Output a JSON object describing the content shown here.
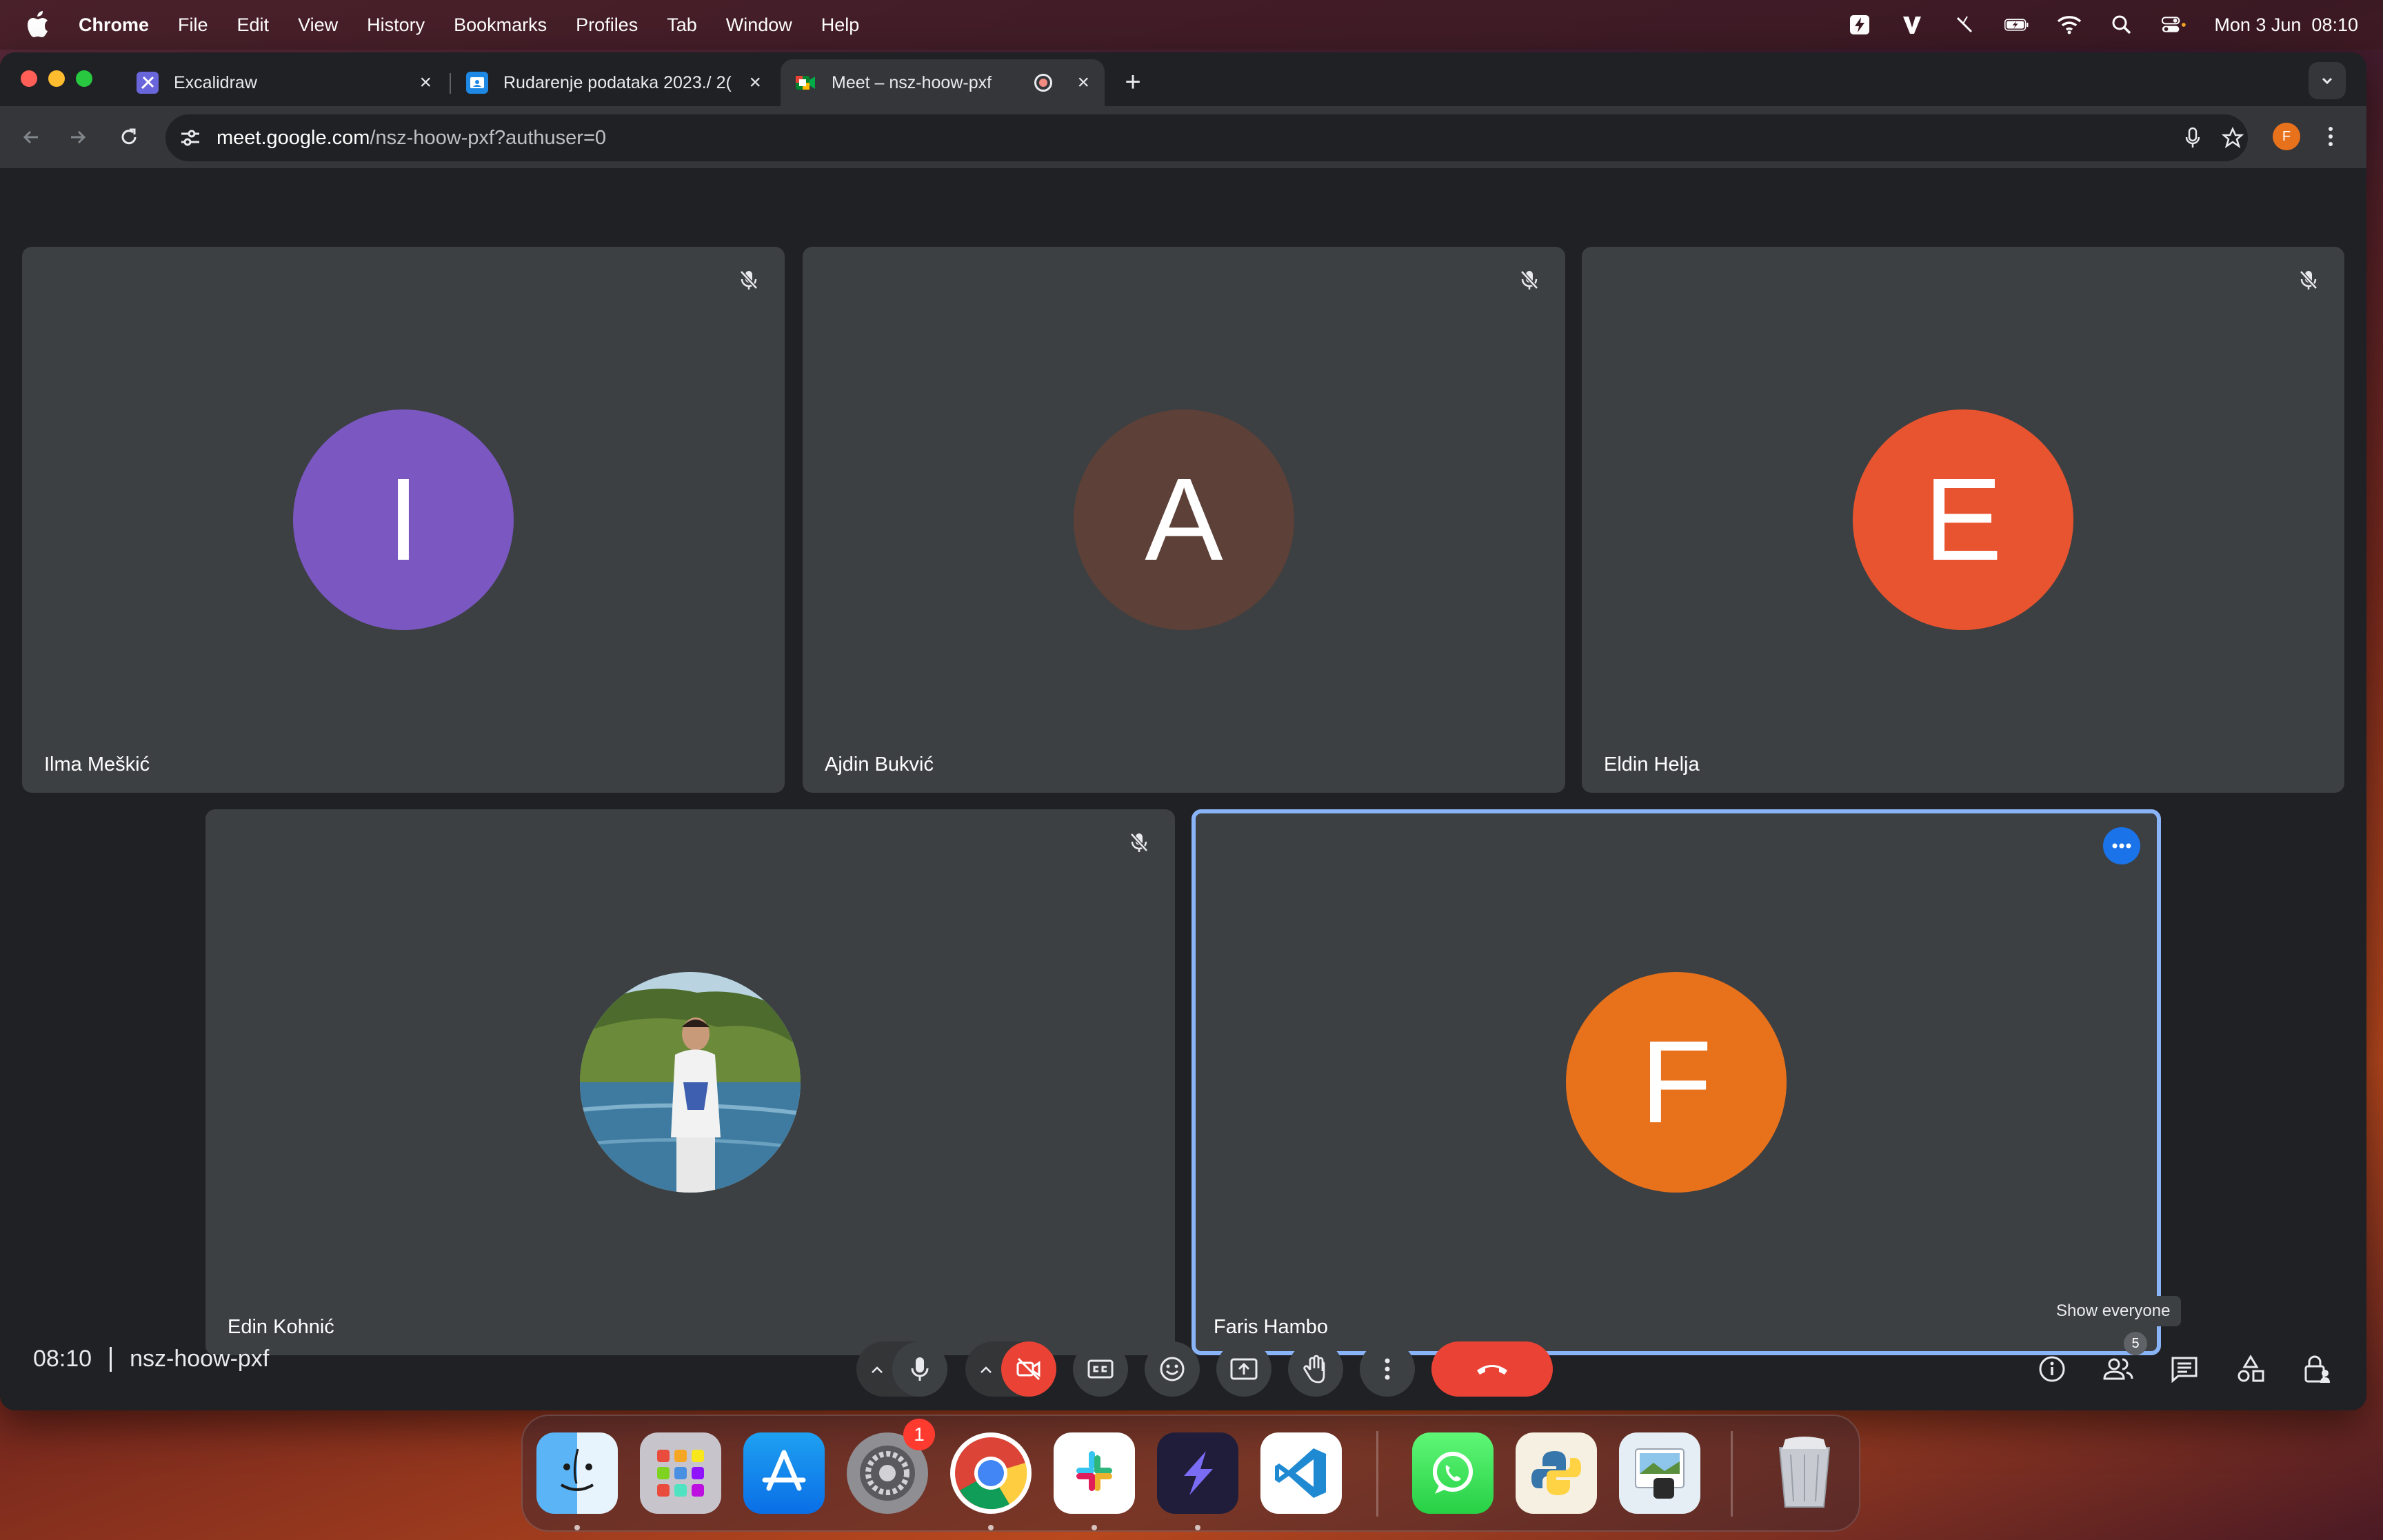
{
  "menubar": {
    "app_name": "Chrome",
    "menus": [
      "File",
      "Edit",
      "View",
      "History",
      "Bookmarks",
      "Profiles",
      "Tab",
      "Window",
      "Help"
    ],
    "clock": "Mon 3 Jun  08:10"
  },
  "browser": {
    "tabs": [
      {
        "title": "Excalidraw",
        "active": false
      },
      {
        "title": "Rudarenje podataka 2023./ 2(",
        "active": false
      },
      {
        "title": "Meet – nsz-hoow-pxf",
        "active": true
      }
    ],
    "url_host": "meet.google.com",
    "url_path": "/nsz-hoow-pxf?authuser=0",
    "profile_initial": "F"
  },
  "meet": {
    "participants": [
      {
        "name": "Ilma Meškić",
        "initial": "I",
        "color": "#7b57c2",
        "muted": true
      },
      {
        "name": "Ajdin Bukvić",
        "initial": "A",
        "color": "#5d4037",
        "muted": true
      },
      {
        "name": "Eldin Helja",
        "initial": "E",
        "color": "#e8542f",
        "muted": true
      },
      {
        "name": "Edin Kohnić",
        "initial": "",
        "color": "#4a7fa0",
        "muted": true,
        "has_photo": true
      },
      {
        "name": "Faris Hambo",
        "initial": "F",
        "color": "#e8711c",
        "muted": false,
        "active": true
      }
    ],
    "time": "08:10",
    "meeting_code": "nsz-hoow-pxf",
    "tooltip": "Show everyone",
    "people_count": "5"
  },
  "dock": {
    "apps": [
      "Finder",
      "Launchpad",
      "App Store",
      "System Settings",
      "Chrome",
      "Slack",
      "Linear",
      "Visual Studio Code",
      "WhatsApp",
      "Python Launcher",
      "Preview",
      "Trash"
    ],
    "settings_badge": "1"
  }
}
